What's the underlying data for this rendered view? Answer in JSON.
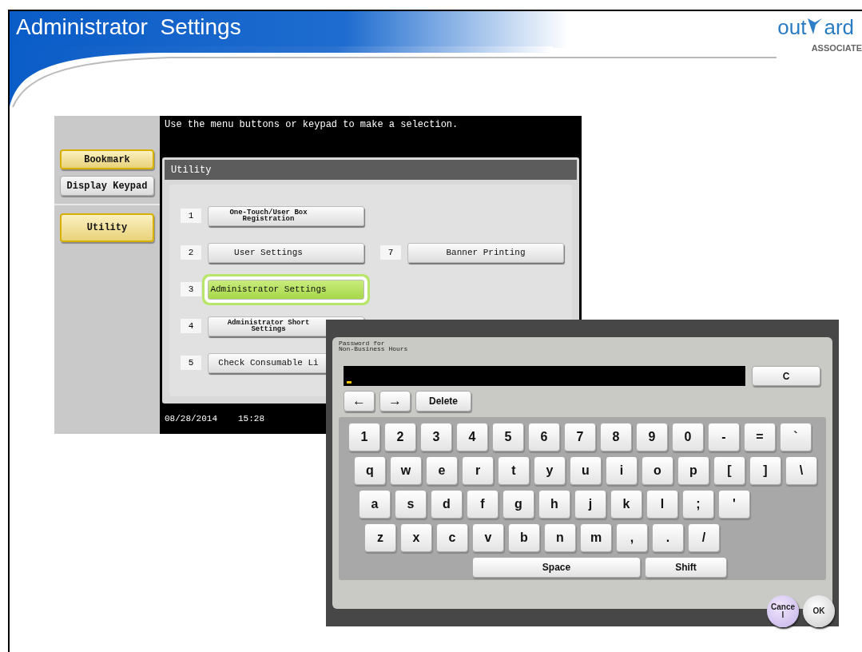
{
  "slide": {
    "title": "Administrator  Settings",
    "logo": {
      "left": "out",
      "right": "ard",
      "tagline": "ASSOCIATE"
    }
  },
  "panel": {
    "sidebar": [
      {
        "label": "Bookmark",
        "selected": true,
        "kind": "small"
      },
      {
        "label": "Display Keypad",
        "selected": false,
        "kind": "small"
      },
      {
        "label": "Utility",
        "selected": true,
        "kind": "large"
      }
    ],
    "message": "Use the menu buttons or keypad to make a selection.",
    "window_title": "Utility",
    "menu_rows": [
      [
        {
          "number": "1",
          "label": "One-Touch/User Box\nRegistration",
          "kind": "twoline",
          "selected": false
        }
      ],
      [
        {
          "number": "2",
          "label": "User Settings",
          "kind": "oneline",
          "selected": false
        },
        {
          "number": "7",
          "label": "Banner Printing",
          "kind": "oneline",
          "selected": false
        }
      ],
      [
        {
          "number": "3",
          "label": "Administrator Settings",
          "kind": "oneline",
          "selected": true
        }
      ],
      [
        {
          "number": "4",
          "label": "Administrator Short\nSettings",
          "kind": "twoline",
          "selected": false
        }
      ],
      [
        {
          "number": "5",
          "label": "Check Consumable Li",
          "kind": "oneline",
          "selected": false
        }
      ]
    ],
    "date": "08/28/2014",
    "time": "15:28"
  },
  "keypad": {
    "title": "Password for\nNon-Business Hours",
    "clear": "C",
    "edit_keys": [
      "←",
      "→",
      "Delete"
    ],
    "key_rows": [
      [
        "1",
        "2",
        "3",
        "4",
        "5",
        "6",
        "7",
        "8",
        "9",
        "0",
        "-",
        "=",
        "`"
      ],
      [
        "q",
        "w",
        "e",
        "r",
        "t",
        "y",
        "u",
        "i",
        "o",
        "p",
        "[",
        "]",
        "\\"
      ],
      [
        "a",
        "s",
        "d",
        "f",
        "g",
        "h",
        "j",
        "k",
        "l",
        ";",
        "'"
      ],
      [
        "z",
        "x",
        "c",
        "v",
        "b",
        "n",
        "m",
        ",",
        ".",
        "/"
      ]
    ],
    "wide_keys": [
      "Space",
      "Shift"
    ],
    "cancel": "Cance\nl",
    "ok": "OK"
  }
}
